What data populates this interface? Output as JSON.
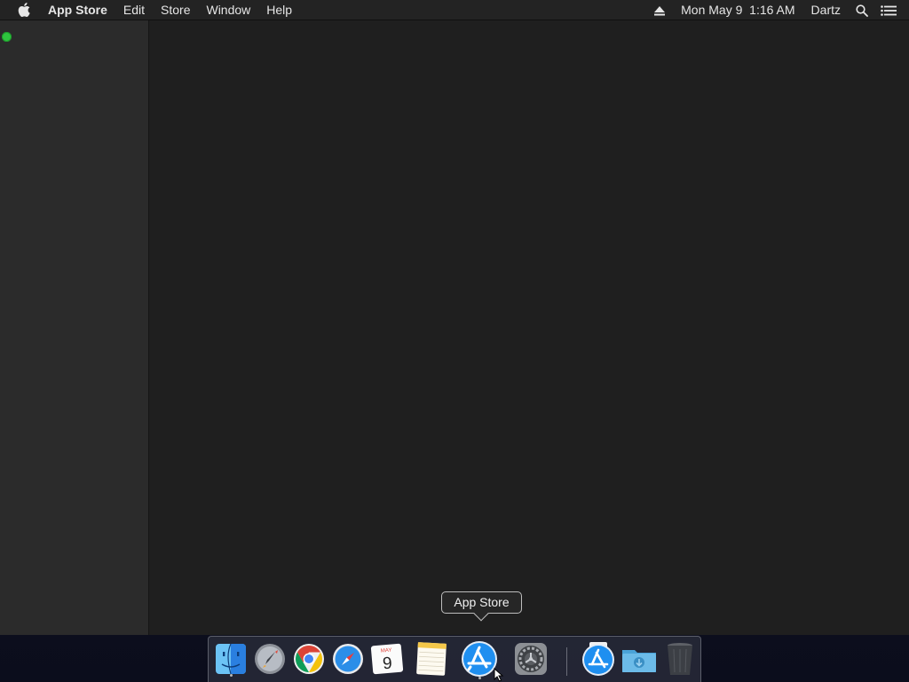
{
  "menubar": {
    "app_name": "App Store",
    "menus": [
      "Edit",
      "Store",
      "Window",
      "Help"
    ],
    "datetime": "Mon May 9  1:16 AM",
    "user": "Dartz",
    "icons": [
      "apple-logo-icon",
      "eject-icon",
      "spotlight-search-icon",
      "notification-center-icon"
    ]
  },
  "window": {
    "traffic_light_color": "#2ec43e"
  },
  "dock": {
    "tooltip": "App Store",
    "items": [
      {
        "name": "Finder",
        "icon": "finder-icon",
        "running": true
      },
      {
        "name": "Launchpad",
        "icon": "launchpad-icon",
        "running": false
      },
      {
        "name": "Google Chrome",
        "icon": "chrome-icon",
        "running": false
      },
      {
        "name": "Safari",
        "icon": "safari-icon",
        "running": false
      },
      {
        "name": "Calendar",
        "icon": "calendar-icon",
        "running": false,
        "month": "MAY",
        "day": "9"
      },
      {
        "name": "Notes",
        "icon": "notes-icon",
        "running": false
      },
      {
        "name": "App Store",
        "icon": "app-store-icon",
        "running": true
      },
      {
        "name": "System Preferences",
        "icon": "system-preferences-icon",
        "running": false
      },
      {
        "name": "App Store Downloads",
        "icon": "app-store-download-icon",
        "running": false
      },
      {
        "name": "Downloads",
        "icon": "downloads-folder-icon",
        "running": false
      },
      {
        "name": "Trash",
        "icon": "trash-icon",
        "running": false
      }
    ]
  },
  "colors": {
    "menubar_bg": "#232323",
    "sidebar_bg": "#2b2b2b",
    "content_bg": "#1f1f1f",
    "accent_blue": "#1f8ff0"
  }
}
